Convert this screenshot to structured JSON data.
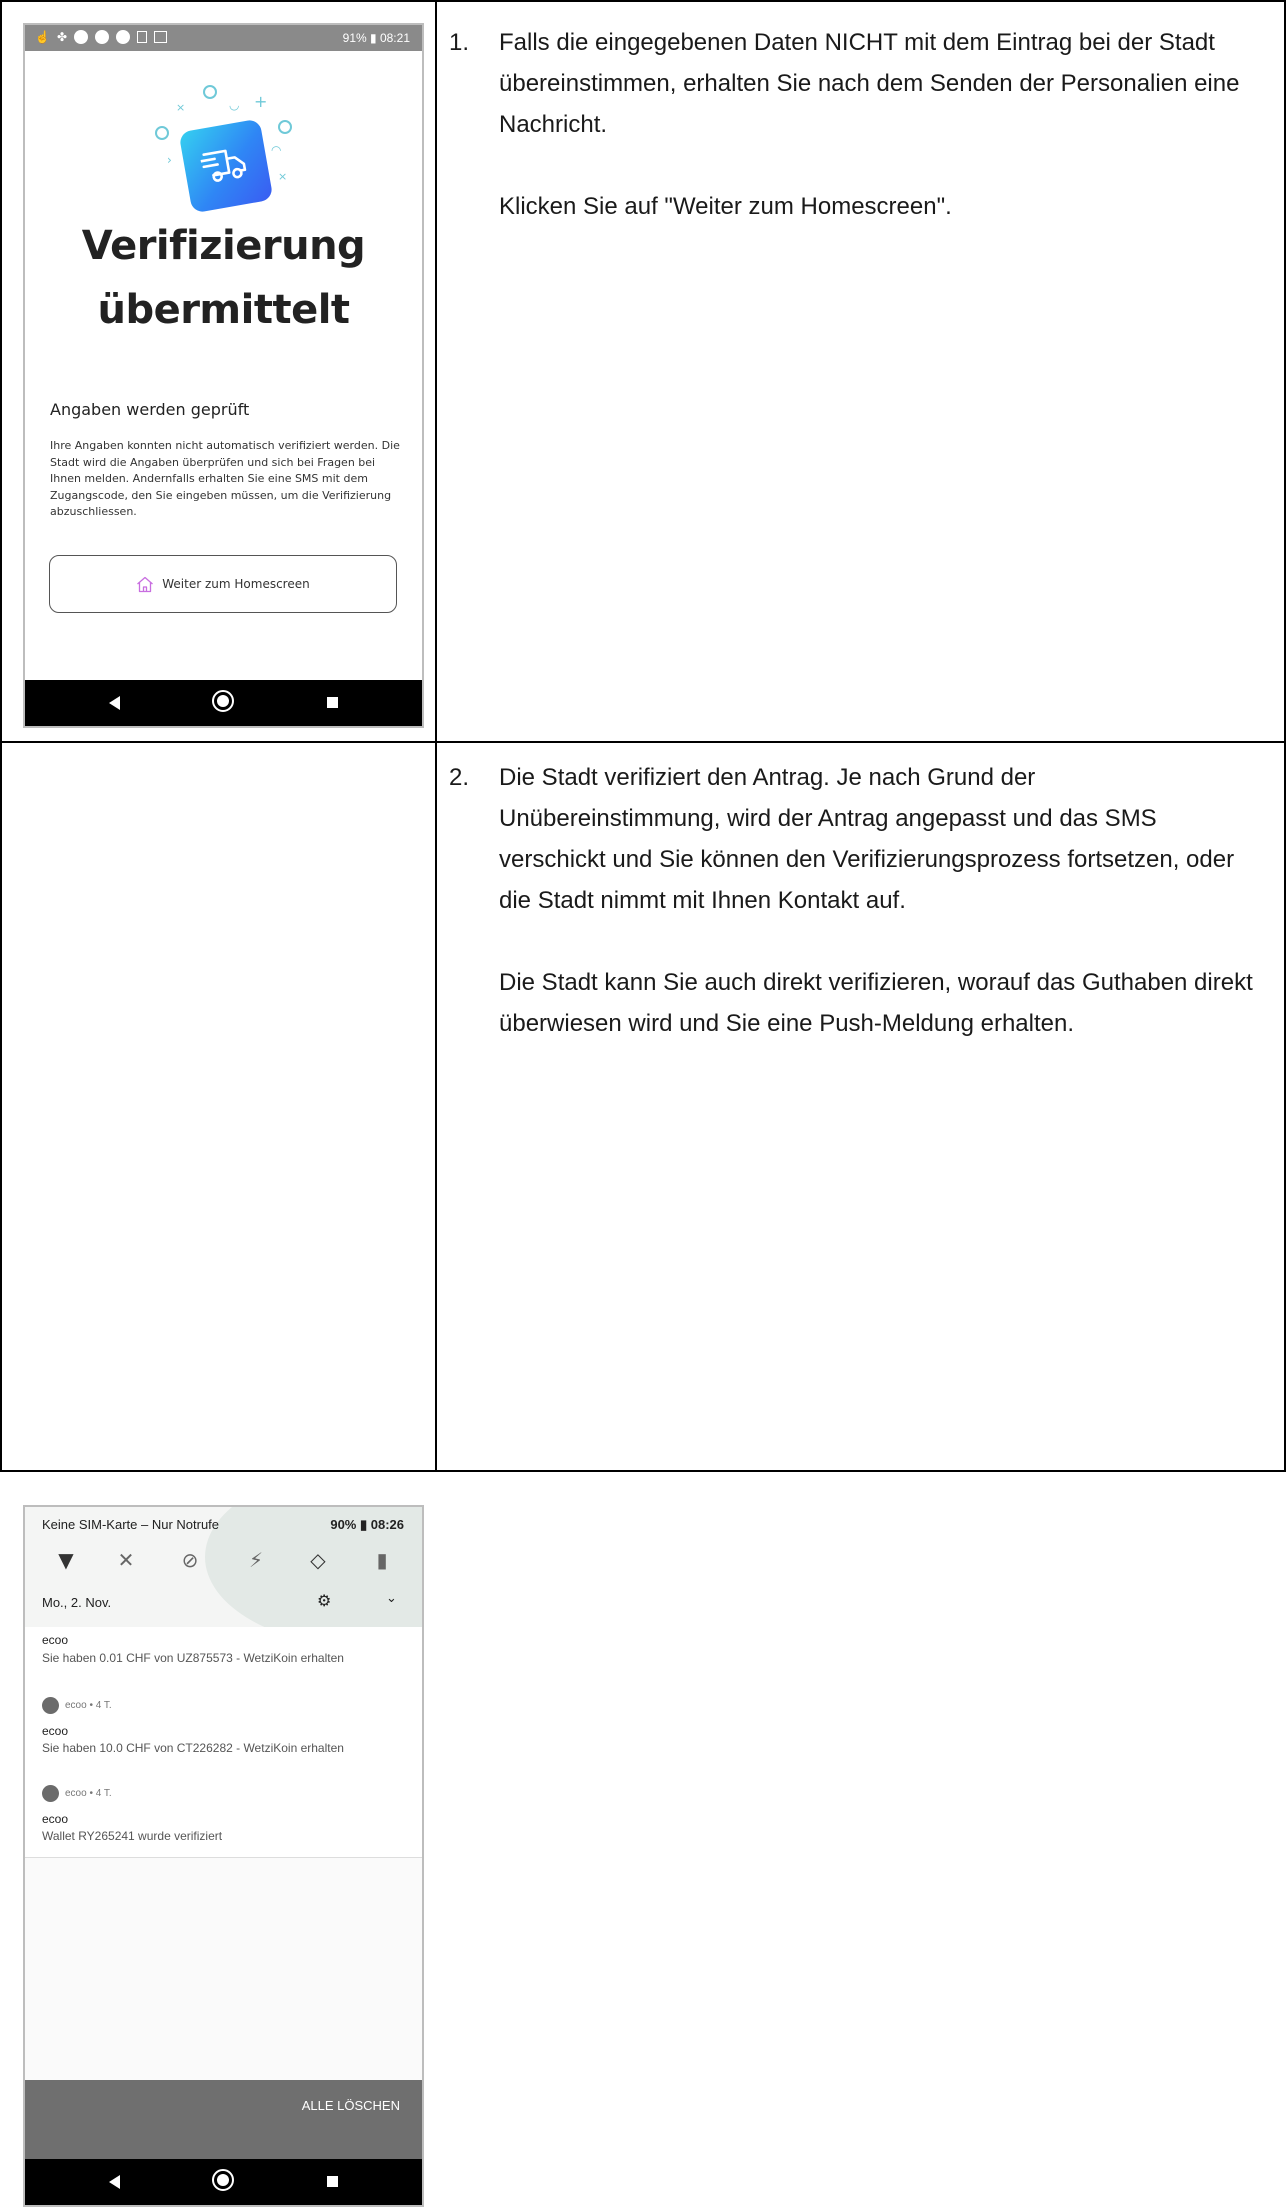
{
  "row1": {
    "instruction_number": "1.",
    "instruction_paragraphs": [
      "Falls die eingegebenen Daten NICHT mit dem Eintrag bei der Stadt übereinstimmen, erhalten Sie nach dem Senden der Personalien eine Nachricht.",
      "Klicken Sie auf \"Weiter zum Homescreen\"."
    ],
    "phone": {
      "status_right": "91% ▮ 08:21",
      "title_line1": "Verifizierung",
      "title_line2": "übermittelt",
      "subtitle": "Angaben werden geprüft",
      "paragraph": "Ihre Angaben konnten nicht automatisch verifiziert werden. Die Stadt wird die Angaben überprüfen und sich bei Fragen bei Ihnen melden. Andernfalls erhalten Sie eine SMS mit dem Zugangscode, den Sie eingeben müssen, um die Verifizierung abzuschliessen.",
      "button_label": "Weiter zum Homescreen",
      "button_icon": "home-icon"
    }
  },
  "row2": {
    "instruction_number": "2.",
    "instruction_paragraphs": [
      "Die Stadt verifiziert den Antrag. Je nach Grund der Unübereinstimmung, wird der Antrag angepasst und das SMS verschickt und Sie können den Verifizierungsprozess fortsetzen, oder die Stadt nimmt mit Ihnen Kontakt auf.",
      "Die Stadt kann Sie auch direkt verifizieren, worauf das Guthaben direkt überwiesen wird und Sie eine Push-Meldung erhalten."
    ],
    "phone": {
      "carrier_text": "Keine SIM-Karte – Nur Notrufe",
      "status_right": "90% ▮ 08:26",
      "date": "Mo., 2. Nov.",
      "quick_icons": [
        "wifi-icon",
        "bluetooth-off-icon",
        "do-not-disturb-icon",
        "flashlight-off-icon",
        "auto-rotate-icon",
        "battery-saver-icon"
      ],
      "notifications": [
        {
          "header": "",
          "app": "ecoo",
          "message": "Sie haben 0.01 CHF von UZ875573 - WetziKoin erhalten"
        },
        {
          "header": "ecoo • 4 T.",
          "app": "ecoo",
          "message": "Sie haben 10.0 CHF von CT226282 - WetziKoin erhalten"
        },
        {
          "header": "ecoo • 4 T.",
          "app": "ecoo",
          "message": "Wallet RY265241 wurde verifiziert"
        }
      ],
      "clear_all_label": "ALLE LÖSCHEN"
    }
  }
}
